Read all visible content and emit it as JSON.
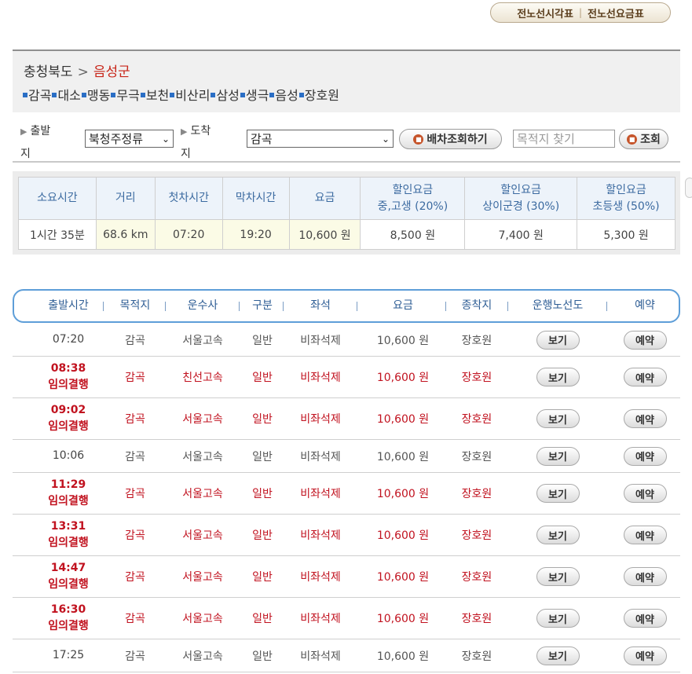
{
  "top_tabs": {
    "timetable": "전노선시각표",
    "fare": "전노선요금표",
    "sep": "|"
  },
  "region": {
    "province": "충청북도",
    "arrow": ">",
    "county": "음성군"
  },
  "stops": [
    "감곡",
    "대소",
    "맹동",
    "무극",
    "보천",
    "비산리",
    "삼성",
    "생극",
    "음성",
    "장호원"
  ],
  "search": {
    "depart_label": "출발지",
    "depart_value": "북청주정류",
    "arrive_label": "도착지",
    "arrive_value": "감곡",
    "query_button": "배차조회하기",
    "dest_placeholder": "목적지 찾기",
    "find_button": "조회"
  },
  "info": {
    "headers": [
      "소요시간",
      "거리",
      "첫차시간",
      "막차시간",
      "요금",
      "할인요금\n중,고생 (20%)",
      "할인요금\n상이군경 (30%)",
      "할인요금\n초등생 (50%)"
    ],
    "values": [
      "1시간 35분",
      "68.6 km",
      "07:20",
      "19:20",
      "10,600 원",
      "8,500 원",
      "7,400 원",
      "5,300 원"
    ]
  },
  "schedule": {
    "headers": [
      "출발시간",
      "목적지",
      "운수사",
      "구분",
      "좌석",
      "요금",
      "종착지",
      "운행노선도",
      "예약"
    ],
    "view_label": "보기",
    "reserve_label": "예약",
    "rows": [
      {
        "time": "07:20",
        "note": "",
        "dest": "감곡",
        "company": "서울고속",
        "type": "일반",
        "seat": "비좌석제",
        "fare": "10,600 원",
        "terminal": "장호원",
        "red": false
      },
      {
        "time": "08:38",
        "note": "임의결행",
        "dest": "감곡",
        "company": "친선고속",
        "type": "일반",
        "seat": "비좌석제",
        "fare": "10,600 원",
        "terminal": "장호원",
        "red": true
      },
      {
        "time": "09:02",
        "note": "임의결행",
        "dest": "감곡",
        "company": "서울고속",
        "type": "일반",
        "seat": "비좌석제",
        "fare": "10,600 원",
        "terminal": "장호원",
        "red": true
      },
      {
        "time": "10:06",
        "note": "",
        "dest": "감곡",
        "company": "서울고속",
        "type": "일반",
        "seat": "비좌석제",
        "fare": "10,600 원",
        "terminal": "장호원",
        "red": false
      },
      {
        "time": "11:29",
        "note": "임의결행",
        "dest": "감곡",
        "company": "서울고속",
        "type": "일반",
        "seat": "비좌석제",
        "fare": "10,600 원",
        "terminal": "장호원",
        "red": true
      },
      {
        "time": "13:31",
        "note": "임의결행",
        "dest": "감곡",
        "company": "서울고속",
        "type": "일반",
        "seat": "비좌석제",
        "fare": "10,600 원",
        "terminal": "장호원",
        "red": true
      },
      {
        "time": "14:47",
        "note": "임의결행",
        "dest": "감곡",
        "company": "서울고속",
        "type": "일반",
        "seat": "비좌석제",
        "fare": "10,600 원",
        "terminal": "장호원",
        "red": true
      },
      {
        "time": "16:30",
        "note": "임의결행",
        "dest": "감곡",
        "company": "서울고속",
        "type": "일반",
        "seat": "비좌석제",
        "fare": "10,600 원",
        "terminal": "장호원",
        "red": true
      },
      {
        "time": "17:25",
        "note": "",
        "dest": "감곡",
        "company": "서울고속",
        "type": "일반",
        "seat": "비좌석제",
        "fare": "10,600 원",
        "terminal": "장호원",
        "red": false
      }
    ]
  },
  "colors": {
    "accent_red": "#c1121f",
    "header_blue": "#2f5e95",
    "border_blue": "#5e9ed8"
  }
}
